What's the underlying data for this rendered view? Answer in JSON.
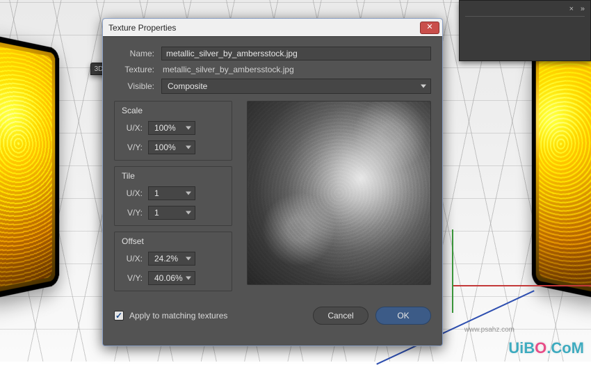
{
  "dialog": {
    "title": "Texture Properties",
    "labels": {
      "name": "Name:",
      "texture": "Texture:",
      "visible": "Visible:"
    },
    "name_value": "metallic_silver_by_ambersstock.jpg",
    "texture_value": "metallic_silver_by_ambersstock.jpg",
    "visible_value": "Composite",
    "groups": {
      "scale": {
        "title": "Scale",
        "ux_label": "U/X:",
        "vy_label": "V/Y:",
        "ux_value": "100%",
        "vy_value": "100%"
      },
      "tile": {
        "title": "Tile",
        "ux_label": "U/X:",
        "vy_label": "V/Y:",
        "ux_value": "1",
        "vy_value": "1"
      },
      "offset": {
        "title": "Offset",
        "ux_label": "U/X:",
        "vy_label": "V/Y:",
        "ux_value": "24.2%",
        "vy_value": "40.06%"
      }
    },
    "apply_checkbox": {
      "label": "Apply to matching textures",
      "checked": true
    },
    "buttons": {
      "cancel": "Cancel",
      "ok": "OK"
    }
  },
  "background": {
    "left_panel_tab": "3D",
    "right_panel_collapse": "»",
    "right_panel_close": "×"
  },
  "watermark": {
    "text_a": "UiB",
    "text_o": "O",
    "text_b": ".CoM",
    "tiny": "www.psahz.com"
  }
}
